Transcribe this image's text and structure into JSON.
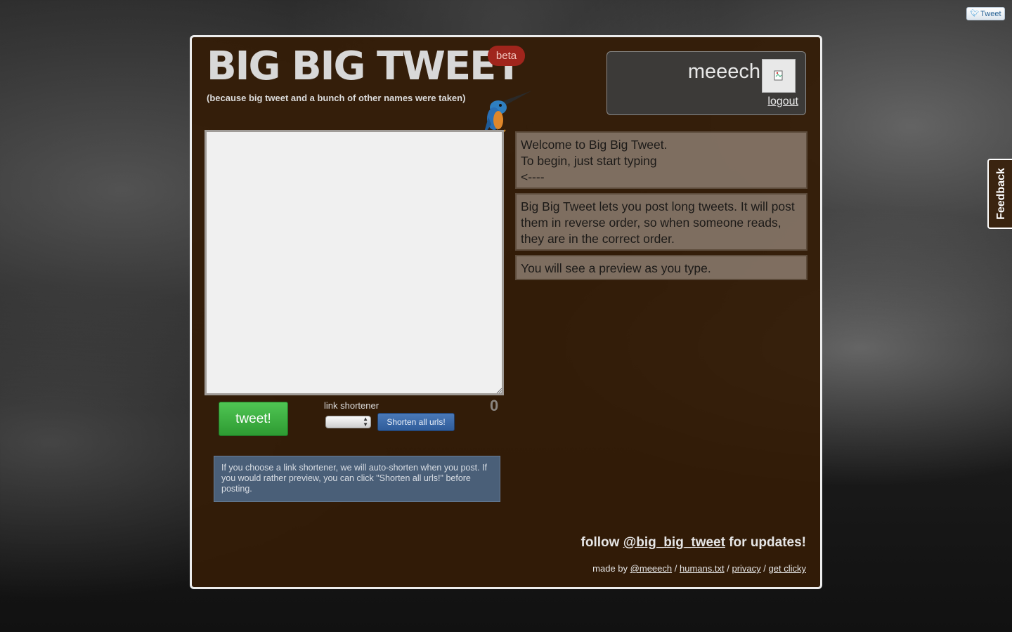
{
  "corner": {
    "tweet_label": "Tweet",
    "bird_icon": "twitter-bird-icon"
  },
  "feedback": {
    "label": "Feedback"
  },
  "header": {
    "logo": "BIG BIG TWEET",
    "beta": "beta",
    "tagline": "(because big tweet and a bunch of other names were taken)",
    "mascot": "kingfisher-bird-icon"
  },
  "user": {
    "name": "meeech",
    "logout": "logout",
    "avatar_icon": "broken-image-icon"
  },
  "composer": {
    "text": "",
    "char_count": "0",
    "tweet_button": "tweet!",
    "link_shortener_label": "link shortener",
    "link_shortener_value": "",
    "shorten_button": "Shorten all urls!",
    "info": "If you choose a link shortener, we will auto-shorten when you post. If you would rather preview, you can click \"Shorten all urls!\" before posting."
  },
  "messages": [
    {
      "lines": [
        "Welcome to Big Big Tweet.",
        "To begin, just start typing",
        "<----"
      ]
    },
    {
      "lines": [
        "Big Big Tweet lets you post long tweets. It will post them in reverse order, so when someone reads, they are in the correct order."
      ]
    },
    {
      "lines": [
        "You will see a preview as you type."
      ]
    }
  ],
  "footer": {
    "follow_prefix": "follow",
    "follow_handle": "@big_big_tweet",
    "follow_suffix": "for updates!",
    "made_by": "made by",
    "author": "@meeech",
    "humans": "humans.txt",
    "privacy": "privacy",
    "get_clicky": "get clicky",
    "separator": "/"
  },
  "colors": {
    "panel_bg": "#341c06",
    "accent_green": "#2e9b32",
    "accent_blue": "#2f5c9a",
    "beta_red": "#a0251c"
  }
}
